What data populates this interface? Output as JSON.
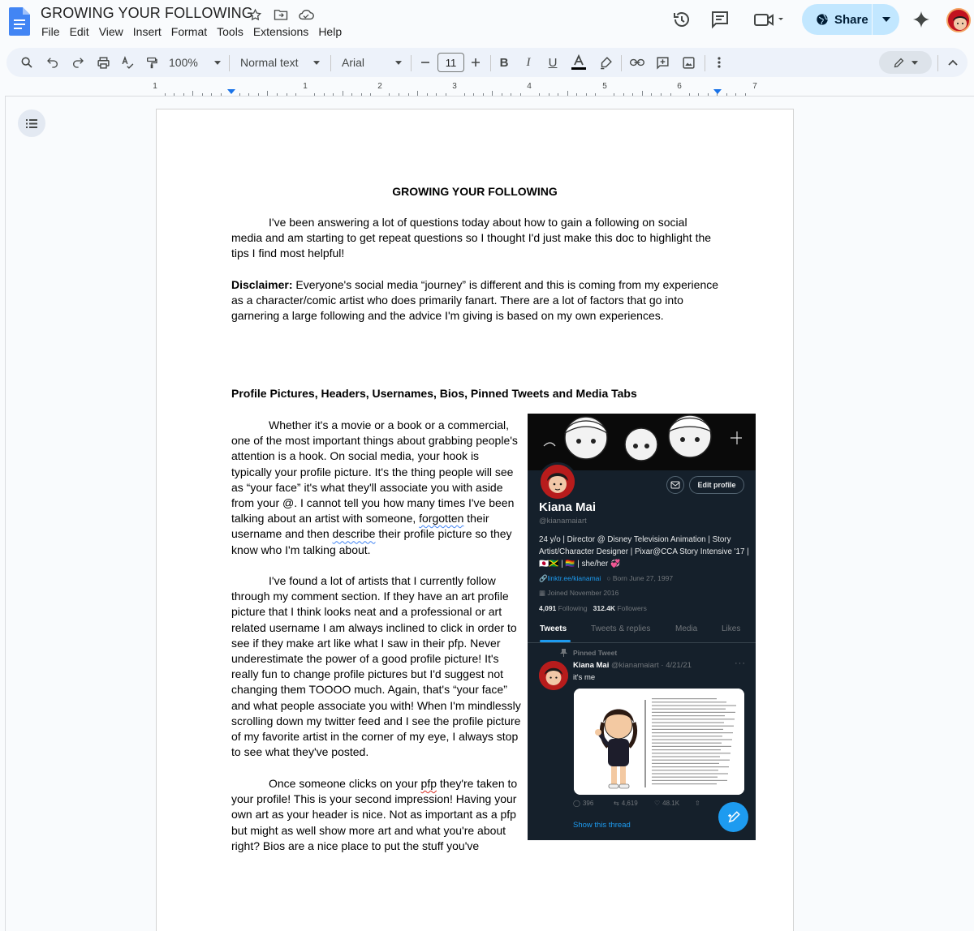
{
  "app": {
    "doc_title": "GROWING YOUR FOLLOWING",
    "menus": [
      "File",
      "Edit",
      "View",
      "Insert",
      "Format",
      "Tools",
      "Extensions",
      "Help"
    ],
    "share_label": "Share"
  },
  "toolbar": {
    "zoom": "100%",
    "style": "Normal text",
    "font": "Arial",
    "font_size": "11"
  },
  "ruler": {
    "numbers": [
      "1",
      "1",
      "2",
      "3",
      "4",
      "5",
      "6",
      "7"
    ]
  },
  "document": {
    "heading": "GROWING YOUR FOLLOWING",
    "intro": "I've been answering a lot of questions today about how to gain a following on social media and am starting to get repeat questions so I thought I'd just make this doc to highlight the tips I find most helpful!",
    "disclaimer_label": "Disclaimer:",
    "disclaimer_text": " Everyone's social media “journey” is different and this is coming from my experience as a character/comic artist who does primarily fanart. There are a lot of factors that go into garnering a large following and the advice I'm giving is based on my own experiences.",
    "section_heading": "Profile Pictures, Headers, Usernames, Bios, Pinned Tweets and Media Tabs",
    "para1_a": "Whether it's a movie or a book or a commercial, one of the most important things about grabbing people's attention is a hook. On social media, your hook is typically your profile picture. It's the thing people will see as “your face” it's what they'll associate you with aside from your @. I cannot tell you how many times I've been talking about an artist with someone, ",
    "para1_w1": "forgotten",
    "para1_b": " their username and then ",
    "para1_w2": "describe",
    "para1_c": " their profile picture so they know who I'm talking about.",
    "para2": "I've found a lot of artists that I currently follow through my comment section. If they have an art profile picture that I think looks neat and a professional or art related username I am always inclined to click in order to see if they make art like what I saw in their pfp. Never underestimate the power of a good profile picture! It's really fun to change profile pictures but I'd suggest not changing them TOOOO much. Again, that's “your face” and what people associate you with! When I'm mindlessly scrolling down my twitter feed and I see the profile picture of my favorite artist in the corner of my eye, I always stop to see what they've posted.",
    "para3_a": "Once someone clicks on your ",
    "para3_w": "pfp",
    "para3_b": " they're taken to your profile! This is your second impression! Having your own art as your header is nice. Not as important as a pfp but might as well show more art and what you're about right? Bios are a nice place to put the stuff you've"
  },
  "twitter": {
    "edit_profile": "Edit profile",
    "name": "Kiana Mai",
    "handle": "@kianamaiart",
    "bio": "24 y/o | Director @ Disney Television Animation | Story Artist/Character Designer | Pixar@CCA Story Intensive '17 | 🇯🇵🇯🇲 | 🏳️‍🌈 | she/her 💞",
    "link": "linktr.ee/kianamai",
    "born": "Born June 27, 1997",
    "joined": "Joined November 2016",
    "following_count": "4,091",
    "following_label": "Following",
    "followers_count": "312.4K",
    "followers_label": "Followers",
    "tabs": [
      "Tweets",
      "Tweets & replies",
      "Media",
      "Likes"
    ],
    "pinned_label": "Pinned Tweet",
    "tweet_name": "Kiana Mai",
    "tweet_meta": "@kianamaiart · 4/21/21",
    "tweet_text": "it's me",
    "replies": "396",
    "retweets": "4,619",
    "likes": "48.1K",
    "show_thread": "Show this thread"
  },
  "colors": {
    "accent": "#1a73e8",
    "share_bg": "#c2e7ff",
    "twitter_bg": "#15202b",
    "twitter_blue": "#1d9bf0"
  }
}
